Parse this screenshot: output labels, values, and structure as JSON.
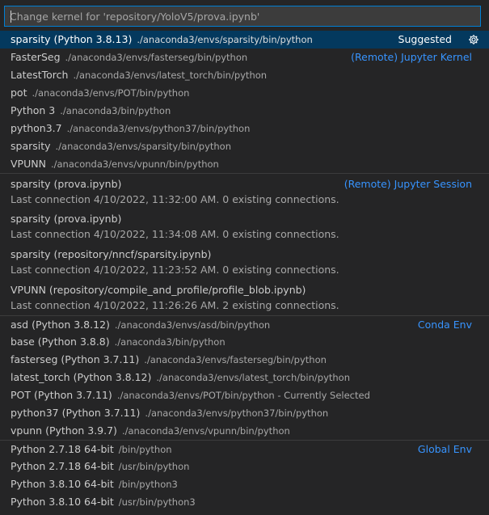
{
  "picker": {
    "placeholder": "Change kernel for 'repository/YoloV5/prova.ipynb'"
  },
  "suggested": {
    "label": "sparsity (Python 3.8.13)",
    "desc": "./anaconda3/envs/sparsity/bin/python",
    "tag": "Suggested",
    "icon": "gear-icon"
  },
  "remote_kernels": {
    "group_label": "(Remote) Jupyter Kernel",
    "items": [
      {
        "label": "FasterSeg",
        "desc": "./anaconda3/envs/fasterseg/bin/python"
      },
      {
        "label": "LatestTorch",
        "desc": "./anaconda3/envs/latest_torch/bin/python"
      },
      {
        "label": "pot",
        "desc": "./anaconda3/envs/POT/bin/python"
      },
      {
        "label": "Python 3",
        "desc": "./anaconda3/bin/python"
      },
      {
        "label": "python3.7",
        "desc": "./anaconda3/envs/python37/bin/python"
      },
      {
        "label": "sparsity",
        "desc": "./anaconda3/envs/sparsity/bin/python"
      },
      {
        "label": "VPUNN",
        "desc": "./anaconda3/envs/vpunn/bin/python"
      }
    ]
  },
  "remote_sessions": {
    "group_label": "(Remote) Jupyter Session",
    "items": [
      {
        "label": "sparsity (prova.ipynb)",
        "detail": "Last connection 4/10/2022, 11:32:00 AM. 0 existing connections."
      },
      {
        "label": "sparsity (prova.ipynb)",
        "detail": "Last connection 4/10/2022, 11:34:08 AM. 0 existing connections."
      },
      {
        "label": "sparsity (repository/nncf/sparsity.ipynb)",
        "detail": "Last connection 4/10/2022, 11:23:52 AM. 0 existing connections."
      },
      {
        "label": "VPUNN (repository/compile_and_profile/profile_blob.ipynb)",
        "detail": "Last connection 4/10/2022, 11:26:26 AM. 2 existing connections."
      }
    ]
  },
  "conda_envs": {
    "group_label": "Conda Env",
    "items": [
      {
        "label": "asd (Python 3.8.12)",
        "desc": "./anaconda3/envs/asd/bin/python"
      },
      {
        "label": "base (Python 3.8.8)",
        "desc": "./anaconda3/bin/python"
      },
      {
        "label": "fasterseg (Python 3.7.11)",
        "desc": "./anaconda3/envs/fasterseg/bin/python"
      },
      {
        "label": "latest_torch (Python 3.8.12)",
        "desc": "./anaconda3/envs/latest_torch/bin/python"
      },
      {
        "label": "POT (Python 3.7.11)",
        "desc": "./anaconda3/envs/POT/bin/python - Currently Selected"
      },
      {
        "label": "python37 (Python 3.7.11)",
        "desc": "./anaconda3/envs/python37/bin/python"
      },
      {
        "label": "vpunn (Python 3.9.7)",
        "desc": "./anaconda3/envs/vpunn/bin/python"
      }
    ]
  },
  "global_envs": {
    "group_label": "Global Env",
    "items": [
      {
        "label": "Python 2.7.18 64-bit",
        "desc": "/bin/python"
      },
      {
        "label": "Python 2.7.18 64-bit",
        "desc": "/usr/bin/python"
      },
      {
        "label": "Python 3.8.10 64-bit",
        "desc": "/bin/python3"
      },
      {
        "label": "Python 3.8.10 64-bit",
        "desc": "/usr/bin/python3"
      }
    ]
  },
  "colors": {
    "background": "#252526",
    "selected_row": "#04395e",
    "focus_border": "#007fd4",
    "group_label": "#3794ff"
  }
}
